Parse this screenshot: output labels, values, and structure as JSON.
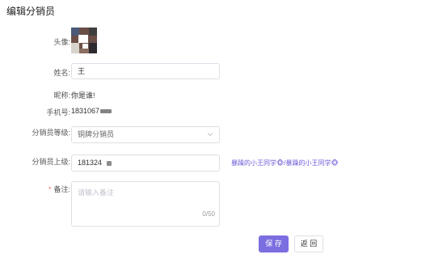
{
  "page": {
    "title": "编辑分销员"
  },
  "form": {
    "avatar": {
      "label": "头像:"
    },
    "name": {
      "label": "姓名:",
      "value": "王"
    },
    "nickname": {
      "label": "昵称:",
      "value": "你是谁!"
    },
    "phone": {
      "label": "手机号:",
      "value": "1831067"
    },
    "level": {
      "label": "分销员等级:",
      "value": "铜牌分销员",
      "icon": "chevron-down-icon"
    },
    "superior": {
      "label": "分销员上级:",
      "value": "181324",
      "link_text": "暴躁的小王同学🐵/暴躁的小王同学🐵"
    },
    "remark": {
      "label": "备注:",
      "required_mark": "*",
      "placeholder": "请输入备注",
      "counter": "0/50"
    }
  },
  "actions": {
    "save": "保 存",
    "back": "返 回"
  },
  "colors": {
    "primary": "#7b6ee0",
    "link": "#6b5bd8",
    "required": "#f56c6c"
  }
}
